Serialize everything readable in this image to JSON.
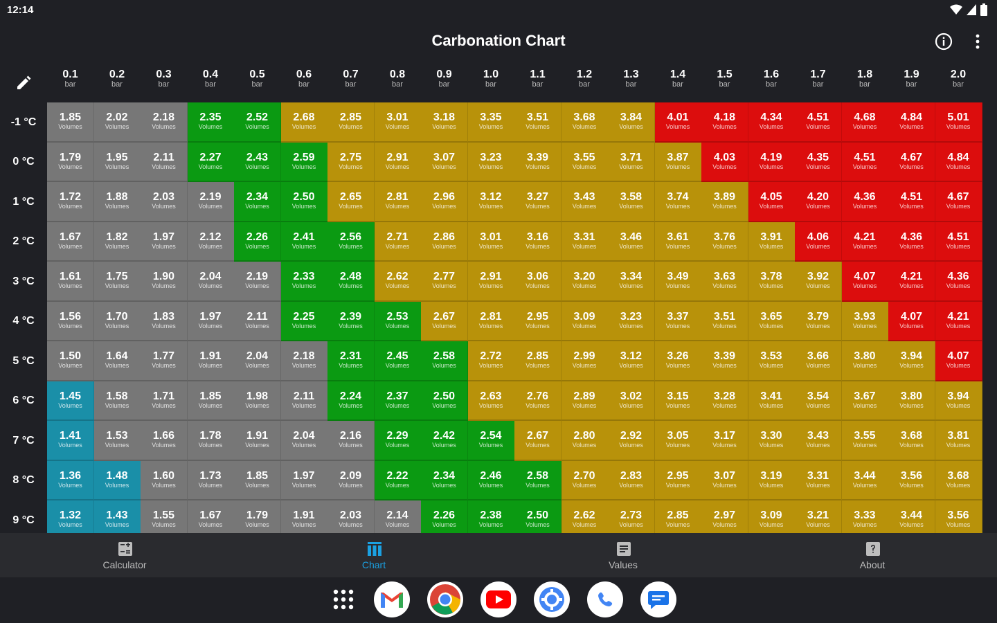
{
  "status": {
    "time": "12:14"
  },
  "app": {
    "title": "Carbonation Chart"
  },
  "columns": [
    {
      "value": "0.1",
      "unit": "bar"
    },
    {
      "value": "0.2",
      "unit": "bar"
    },
    {
      "value": "0.3",
      "unit": "bar"
    },
    {
      "value": "0.4",
      "unit": "bar"
    },
    {
      "value": "0.5",
      "unit": "bar"
    },
    {
      "value": "0.6",
      "unit": "bar"
    },
    {
      "value": "0.7",
      "unit": "bar"
    },
    {
      "value": "0.8",
      "unit": "bar"
    },
    {
      "value": "0.9",
      "unit": "bar"
    },
    {
      "value": "1.0",
      "unit": "bar"
    },
    {
      "value": "1.1",
      "unit": "bar"
    },
    {
      "value": "1.2",
      "unit": "bar"
    },
    {
      "value": "1.3",
      "unit": "bar"
    },
    {
      "value": "1.4",
      "unit": "bar"
    },
    {
      "value": "1.5",
      "unit": "bar"
    },
    {
      "value": "1.6",
      "unit": "bar"
    },
    {
      "value": "1.7",
      "unit": "bar"
    },
    {
      "value": "1.8",
      "unit": "bar"
    },
    {
      "value": "1.9",
      "unit": "bar"
    },
    {
      "value": "2.0",
      "unit": "bar"
    }
  ],
  "cell_unit": "Volumes",
  "colors": {
    "blue": "#1a8fa8",
    "gray": "#777777",
    "green": "#0b9a12",
    "gold": "#b8920a",
    "red": "#dc0d0d"
  },
  "rows": [
    {
      "label": "-1 °C",
      "values": [
        "1.85",
        "2.02",
        "2.18",
        "2.35",
        "2.52",
        "2.68",
        "2.85",
        "3.01",
        "3.18",
        "3.35",
        "3.51",
        "3.68",
        "3.84",
        "4.01",
        "4.18",
        "4.34",
        "4.51",
        "4.68",
        "4.84",
        "5.01"
      ],
      "colors": [
        "gray",
        "gray",
        "gray",
        "green",
        "green",
        "gold",
        "gold",
        "gold",
        "gold",
        "gold",
        "gold",
        "gold",
        "gold",
        "red",
        "red",
        "red",
        "red",
        "red",
        "red",
        "red"
      ]
    },
    {
      "label": "0 °C",
      "values": [
        "1.79",
        "1.95",
        "2.11",
        "2.27",
        "2.43",
        "2.59",
        "2.75",
        "2.91",
        "3.07",
        "3.23",
        "3.39",
        "3.55",
        "3.71",
        "3.87",
        "4.03",
        "4.19",
        "4.35",
        "4.51",
        "4.67",
        "4.84"
      ],
      "colors": [
        "gray",
        "gray",
        "gray",
        "green",
        "green",
        "green",
        "gold",
        "gold",
        "gold",
        "gold",
        "gold",
        "gold",
        "gold",
        "gold",
        "red",
        "red",
        "red",
        "red",
        "red",
        "red"
      ]
    },
    {
      "label": "1 °C",
      "values": [
        "1.72",
        "1.88",
        "2.03",
        "2.19",
        "2.34",
        "2.50",
        "2.65",
        "2.81",
        "2.96",
        "3.12",
        "3.27",
        "3.43",
        "3.58",
        "3.74",
        "3.89",
        "4.05",
        "4.20",
        "4.36",
        "4.51",
        "4.67"
      ],
      "colors": [
        "gray",
        "gray",
        "gray",
        "gray",
        "green",
        "green",
        "gold",
        "gold",
        "gold",
        "gold",
        "gold",
        "gold",
        "gold",
        "gold",
        "gold",
        "red",
        "red",
        "red",
        "red",
        "red"
      ]
    },
    {
      "label": "2 °C",
      "values": [
        "1.67",
        "1.82",
        "1.97",
        "2.12",
        "2.26",
        "2.41",
        "2.56",
        "2.71",
        "2.86",
        "3.01",
        "3.16",
        "3.31",
        "3.46",
        "3.61",
        "3.76",
        "3.91",
        "4.06",
        "4.21",
        "4.36",
        "4.51"
      ],
      "colors": [
        "gray",
        "gray",
        "gray",
        "gray",
        "green",
        "green",
        "green",
        "gold",
        "gold",
        "gold",
        "gold",
        "gold",
        "gold",
        "gold",
        "gold",
        "gold",
        "red",
        "red",
        "red",
        "red"
      ]
    },
    {
      "label": "3 °C",
      "values": [
        "1.61",
        "1.75",
        "1.90",
        "2.04",
        "2.19",
        "2.33",
        "2.48",
        "2.62",
        "2.77",
        "2.91",
        "3.06",
        "3.20",
        "3.34",
        "3.49",
        "3.63",
        "3.78",
        "3.92",
        "4.07",
        "4.21",
        "4.36"
      ],
      "colors": [
        "gray",
        "gray",
        "gray",
        "gray",
        "gray",
        "green",
        "green",
        "gold",
        "gold",
        "gold",
        "gold",
        "gold",
        "gold",
        "gold",
        "gold",
        "gold",
        "gold",
        "red",
        "red",
        "red"
      ]
    },
    {
      "label": "4 °C",
      "values": [
        "1.56",
        "1.70",
        "1.83",
        "1.97",
        "2.11",
        "2.25",
        "2.39",
        "2.53",
        "2.67",
        "2.81",
        "2.95",
        "3.09",
        "3.23",
        "3.37",
        "3.51",
        "3.65",
        "3.79",
        "3.93",
        "4.07",
        "4.21"
      ],
      "colors": [
        "gray",
        "gray",
        "gray",
        "gray",
        "gray",
        "green",
        "green",
        "green",
        "gold",
        "gold",
        "gold",
        "gold",
        "gold",
        "gold",
        "gold",
        "gold",
        "gold",
        "gold",
        "red",
        "red"
      ]
    },
    {
      "label": "5 °C",
      "values": [
        "1.50",
        "1.64",
        "1.77",
        "1.91",
        "2.04",
        "2.18",
        "2.31",
        "2.45",
        "2.58",
        "2.72",
        "2.85",
        "2.99",
        "3.12",
        "3.26",
        "3.39",
        "3.53",
        "3.66",
        "3.80",
        "3.94",
        "4.07"
      ],
      "colors": [
        "gray",
        "gray",
        "gray",
        "gray",
        "gray",
        "gray",
        "green",
        "green",
        "green",
        "gold",
        "gold",
        "gold",
        "gold",
        "gold",
        "gold",
        "gold",
        "gold",
        "gold",
        "gold",
        "red"
      ]
    },
    {
      "label": "6 °C",
      "values": [
        "1.45",
        "1.58",
        "1.71",
        "1.85",
        "1.98",
        "2.11",
        "2.24",
        "2.37",
        "2.50",
        "2.63",
        "2.76",
        "2.89",
        "3.02",
        "3.15",
        "3.28",
        "3.41",
        "3.54",
        "3.67",
        "3.80",
        "3.94"
      ],
      "colors": [
        "blue",
        "gray",
        "gray",
        "gray",
        "gray",
        "gray",
        "green",
        "green",
        "green",
        "gold",
        "gold",
        "gold",
        "gold",
        "gold",
        "gold",
        "gold",
        "gold",
        "gold",
        "gold",
        "gold"
      ]
    },
    {
      "label": "7 °C",
      "values": [
        "1.41",
        "1.53",
        "1.66",
        "1.78",
        "1.91",
        "2.04",
        "2.16",
        "2.29",
        "2.42",
        "2.54",
        "2.67",
        "2.80",
        "2.92",
        "3.05",
        "3.17",
        "3.30",
        "3.43",
        "3.55",
        "3.68",
        "3.81"
      ],
      "colors": [
        "blue",
        "gray",
        "gray",
        "gray",
        "gray",
        "gray",
        "gray",
        "green",
        "green",
        "green",
        "gold",
        "gold",
        "gold",
        "gold",
        "gold",
        "gold",
        "gold",
        "gold",
        "gold",
        "gold"
      ]
    },
    {
      "label": "8 °C",
      "values": [
        "1.36",
        "1.48",
        "1.60",
        "1.73",
        "1.85",
        "1.97",
        "2.09",
        "2.22",
        "2.34",
        "2.46",
        "2.58",
        "2.70",
        "2.83",
        "2.95",
        "3.07",
        "3.19",
        "3.31",
        "3.44",
        "3.56",
        "3.68"
      ],
      "colors": [
        "blue",
        "blue",
        "gray",
        "gray",
        "gray",
        "gray",
        "gray",
        "green",
        "green",
        "green",
        "green",
        "gold",
        "gold",
        "gold",
        "gold",
        "gold",
        "gold",
        "gold",
        "gold",
        "gold"
      ]
    },
    {
      "label": "9 °C",
      "values": [
        "1.32",
        "1.43",
        "1.55",
        "1.67",
        "1.79",
        "1.91",
        "2.03",
        "2.14",
        "2.26",
        "2.38",
        "2.50",
        "2.62",
        "2.73",
        "2.85",
        "2.97",
        "3.09",
        "3.21",
        "3.33",
        "3.44",
        "3.56"
      ],
      "colors": [
        "blue",
        "blue",
        "gray",
        "gray",
        "gray",
        "gray",
        "gray",
        "gray",
        "green",
        "green",
        "green",
        "gold",
        "gold",
        "gold",
        "gold",
        "gold",
        "gold",
        "gold",
        "gold",
        "gold"
      ]
    }
  ],
  "bottom_nav": [
    {
      "label": "Calculator",
      "icon": "calculator-icon",
      "active": false
    },
    {
      "label": "Chart",
      "icon": "chart-icon",
      "active": true
    },
    {
      "label": "Values",
      "icon": "values-icon",
      "active": false
    },
    {
      "label": "About",
      "icon": "about-icon",
      "active": false
    }
  ],
  "dock": [
    "apps-grid-icon",
    "gmail-icon",
    "chrome-icon",
    "youtube-icon",
    "settings-icon",
    "phone-icon",
    "messages-icon"
  ]
}
